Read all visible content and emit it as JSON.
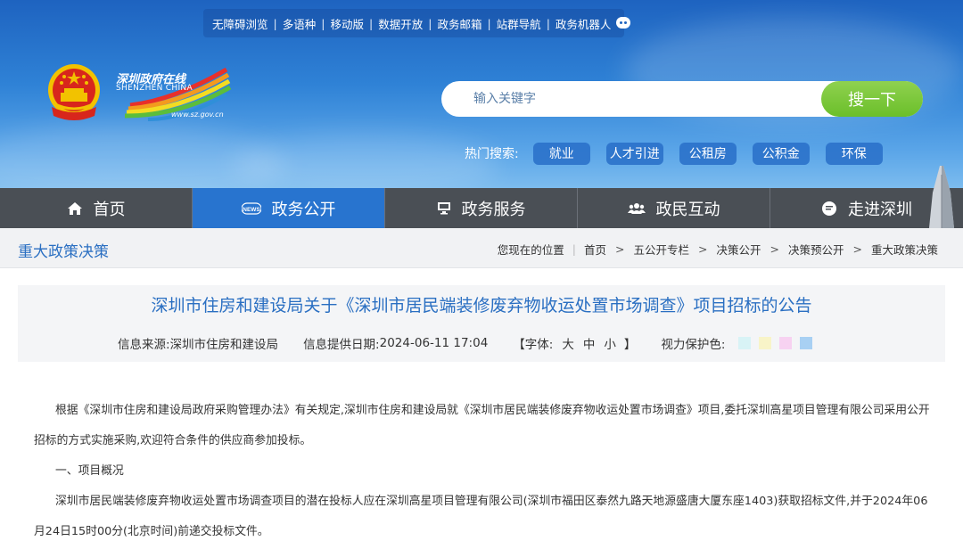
{
  "topbar": {
    "links": [
      "无障碍浏览",
      "多语种",
      "移动版",
      "数据开放",
      "政务邮箱",
      "站群导航",
      "政务机器人"
    ]
  },
  "logo": {
    "site_name_cn": "深圳政府在线",
    "site_name_en": "SHENZHEN CHINA",
    "url_text": "www.sz.gov.cn"
  },
  "search": {
    "placeholder": "输入关键字",
    "button_label": "搜一下"
  },
  "hot_search": {
    "label": "热门搜索:",
    "tags": [
      "就业",
      "人才引进",
      "公租房",
      "公积金",
      "环保"
    ]
  },
  "nav": {
    "items": [
      {
        "label": "首页",
        "icon": "home-icon"
      },
      {
        "label": "政务公开",
        "icon": "news-icon"
      },
      {
        "label": "政务服务",
        "icon": "monitor-icon"
      },
      {
        "label": "政民互动",
        "icon": "people-icon"
      },
      {
        "label": "走进深圳",
        "icon": "chat-icon"
      }
    ],
    "active_index": 1
  },
  "breadcrumb": {
    "section_title": "重大政策决策",
    "location_label": "您现在的位置",
    "items": [
      "首页",
      "五公开专栏",
      "决策公开",
      "决策预公开",
      "重大政策决策"
    ]
  },
  "article": {
    "title": "深圳市住房和建设局关于《深圳市居民端装修废弃物收运处置市场调查》项目招标的公告",
    "source_label": "信息来源:",
    "source": "深圳市住房和建设局",
    "date_label": "信息提供日期:",
    "date": "2024-06-11 17:04",
    "font_label": "【字体:",
    "font_sizes": [
      "大",
      "中",
      "小"
    ],
    "font_close": "】",
    "eye_care_label": "视力保护色:",
    "eye_care_colors": [
      "#d8f3f6",
      "#f8f4c8",
      "#f7d2f1",
      "#a8d0f3"
    ],
    "paragraphs": [
      "根据《深圳市住房和建设局政府采购管理办法》有关规定,深圳市住房和建设局就《深圳市居民端装修废弃物收运处置市场调查》项目,委托深圳高星项目管理有限公司采用公开招标的方式实施采购,欢迎符合条件的供应商参加投标。",
      "一、项目概况",
      "深圳市居民端装修废弃物收运处置市场调查项目的潜在投标人应在深圳高星项目管理有限公司(深圳市福田区泰然九路天地源盛唐大厦东座1403)获取招标文件,并于2024年06月24日15时00分(北京时间)前递交投标文件。"
    ]
  },
  "colors": {
    "nav_bg": "#4a4f55",
    "nav_active": "#2874cf",
    "accent_blue": "#2a6fc2",
    "search_btn": "#7cc63b"
  }
}
